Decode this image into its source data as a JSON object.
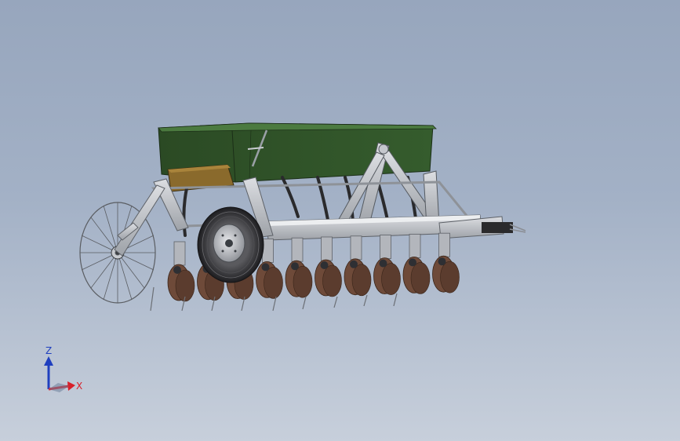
{
  "triad": {
    "z_label": "Z",
    "x_label": "X",
    "z_color": "#1f3fbf",
    "x_color": "#d8202a"
  },
  "colors": {
    "hopper_green": "#2f4f27",
    "hopper_light": "#3e6a34",
    "box_tan": "#8a6a2c",
    "frame_gray": "#b9bcc2",
    "disc_brown": "#6e4a39",
    "tire_dark": "#2c2c2e"
  }
}
